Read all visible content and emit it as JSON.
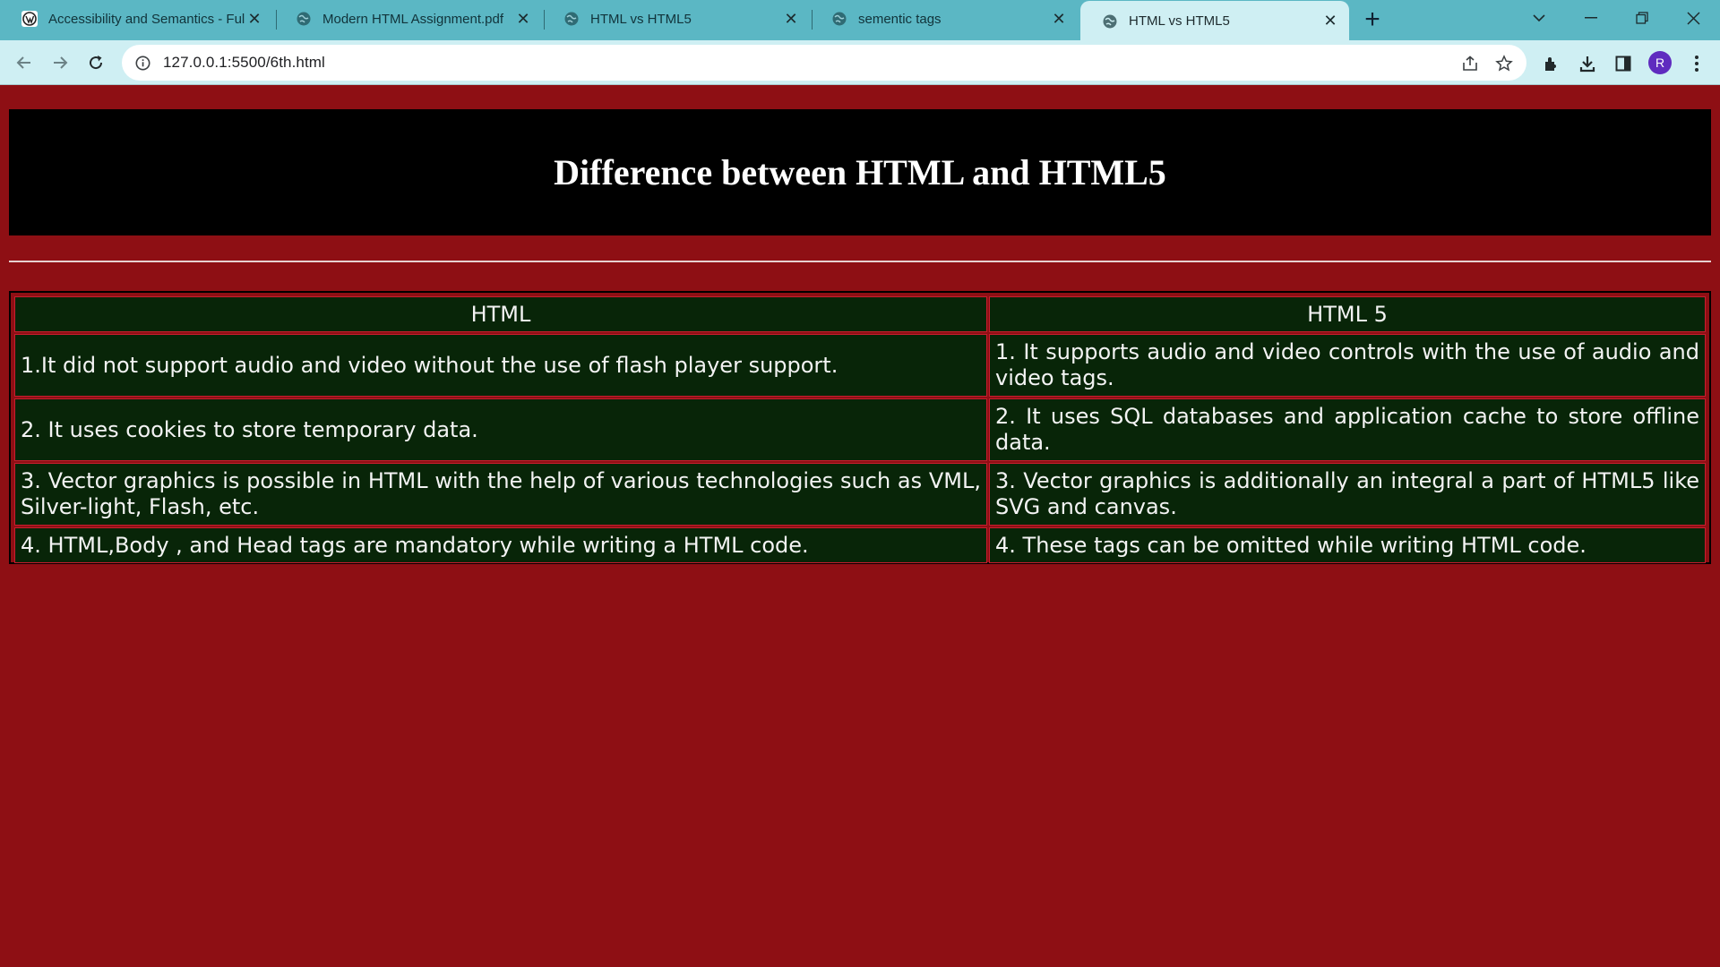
{
  "browser": {
    "tabs": [
      {
        "title": "Accessibility and Semantics - Full",
        "favicon": "wordpress-icon",
        "active": false
      },
      {
        "title": "Modern HTML Assignment.pdf",
        "favicon": "globe-icon",
        "active": false
      },
      {
        "title": "HTML vs HTML5",
        "favicon": "globe-icon",
        "active": false
      },
      {
        "title": "sementic tags",
        "favicon": "globe-icon",
        "active": false
      },
      {
        "title": "HTML vs HTML5",
        "favicon": "globe-icon",
        "active": true
      }
    ],
    "address": "127.0.0.1:5500/6th.html",
    "profile_initial": "R"
  },
  "page": {
    "heading": "Difference between HTML and HTML5",
    "table": {
      "headers": [
        "HTML",
        "HTML 5"
      ],
      "rows": [
        [
          "1.It did not support audio and video without the use of flash player support.",
          "1. It supports audio and video controls with the use of audio and video tags."
        ],
        [
          "2. It uses cookies to store temporary data.",
          "2. It uses SQL databases and application cache to store offline data."
        ],
        [
          "3. Vector graphics is possible in HTML with the help of various technologies such as VML, Silver-light, Flash, etc.",
          "3. Vector graphics is additionally an integral a part of HTML5 like SVG and canvas."
        ],
        [
          "4. HTML,Body , and Head tags are mandatory while writing a HTML code.",
          "4. These tags can be omitted while writing HTML code."
        ]
      ]
    }
  },
  "colors": {
    "page_background": "#8e0f14",
    "header_background": "#000000",
    "cell_background": "#082508",
    "cell_border": "#c81d2e",
    "tabstrip": "#5bb7c4",
    "toolbar": "#cfeff3"
  }
}
